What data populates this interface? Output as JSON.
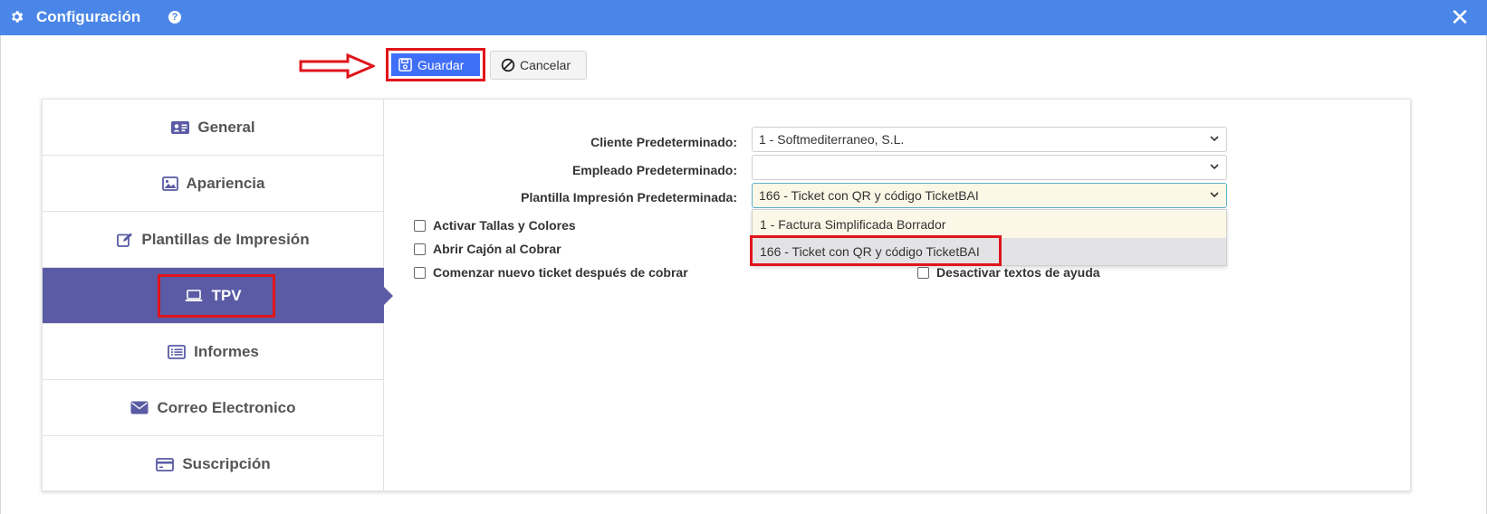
{
  "header": {
    "title": "Configuración",
    "color": "#4a86e8"
  },
  "toolbar": {
    "save_label": "Guardar",
    "cancel_label": "Cancelar"
  },
  "sidebar": {
    "items": [
      {
        "label": "General",
        "icon": "id-card-icon"
      },
      {
        "label": "Apariencia",
        "icon": "image-icon"
      },
      {
        "label": "Plantillas de Impresión",
        "icon": "edit-icon"
      },
      {
        "label": "TPV",
        "icon": "laptop-icon",
        "active": true
      },
      {
        "label": "Informes",
        "icon": "list-icon"
      },
      {
        "label": "Correo Electronico",
        "icon": "envelope-icon"
      },
      {
        "label": "Suscripción",
        "icon": "credit-card-icon"
      }
    ],
    "active_color": "#5a5ba4"
  },
  "form": {
    "cliente_label": "Cliente Predeterminado:",
    "cliente_value": "1 - Softmediterraneo, S.L.",
    "empleado_label": "Empleado Predeterminado:",
    "empleado_value": "",
    "plantilla_label": "Plantilla Impresión Predeterminada:",
    "plantilla_value": "166 - Ticket con QR y código TicketBAI",
    "plantilla_options": [
      "1 - Factura Simplificada Borrador",
      "166 - Ticket con QR y código TicketBAI"
    ]
  },
  "checkboxes": {
    "activar_tallas": "Activar Tallas y Colores",
    "abrir_cajon": "Abrir Cajón al Cobrar",
    "nuevo_ticket": "Comenzar nuevo ticket después de cobrar",
    "desactivar_textos": "Desactivar textos de ayuda"
  },
  "highlight_color": "#e0151b"
}
